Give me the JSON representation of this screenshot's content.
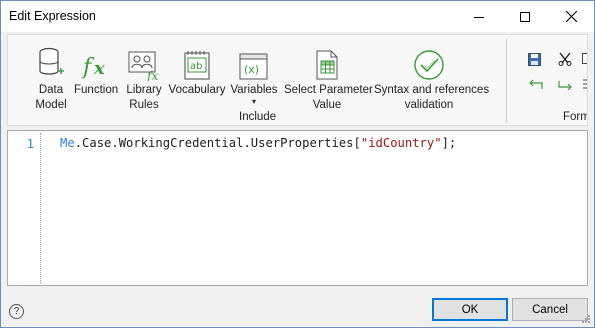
{
  "window": {
    "title": "Edit Expression",
    "controls": [
      "minimize-icon",
      "maximize-icon",
      "close-icon"
    ]
  },
  "ribbon": {
    "tools": [
      {
        "id": "data-model",
        "label": "Data\nModel",
        "icon": "database-add-icon"
      },
      {
        "id": "function",
        "label": "Function",
        "icon": "fx-icon"
      },
      {
        "id": "library-rules",
        "label": "Library\nRules",
        "icon": "library-rules-icon"
      },
      {
        "id": "vocabulary",
        "label": "Vocabulary",
        "icon": "vocabulary-icon"
      },
      {
        "id": "variables",
        "label": "Variables",
        "icon": "variables-icon"
      },
      {
        "id": "select-parameter",
        "label": "Select Parameter\nValue",
        "icon": "table-grid-icon"
      },
      {
        "id": "syntax",
        "label": "Syntax and references\nvalidation",
        "icon": "check-circle-icon"
      }
    ],
    "include_label": "Include",
    "format_label": "Form",
    "variables_dropdown": "▾"
  },
  "editor": {
    "line_number": "1",
    "code_object": "Me",
    "code_path": ".Case.WorkingCredential.UserProperties[",
    "code_string": "\"idCountry\"",
    "code_end": "];"
  },
  "footer": {
    "ok_label": "OK",
    "cancel_label": "Cancel",
    "help_label": "?"
  },
  "colors": {
    "accent": "#0078d7",
    "keyword": "#2b7fd6",
    "string": "#a31515",
    "line_number": "#2b91af"
  }
}
